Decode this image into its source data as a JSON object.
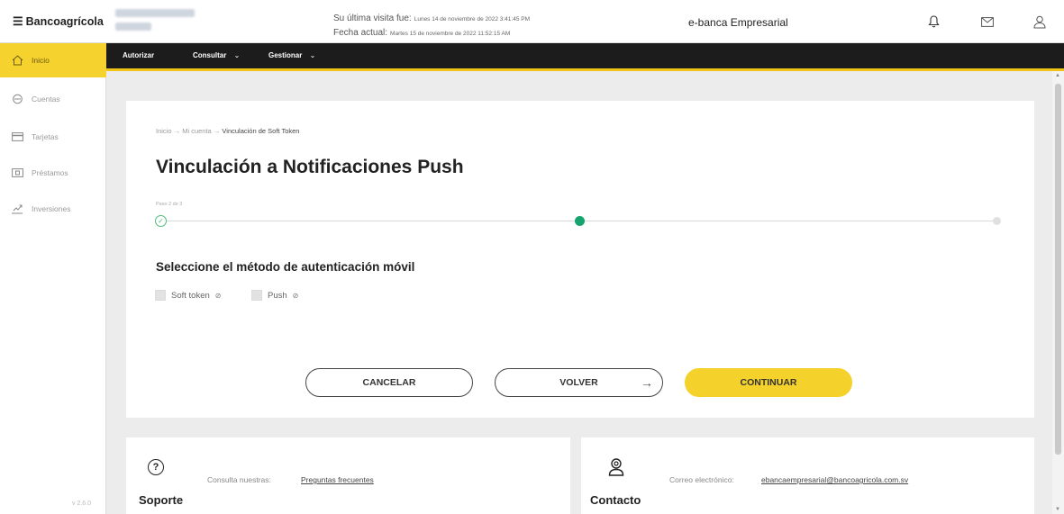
{
  "header": {
    "brand": "Bancoagrícola",
    "last_visit_label": "Su última visita fue:",
    "last_visit_value": "Lunes 14 de noviembre de 2022 3:41:45 PM",
    "current_date_label": "Fecha actual:",
    "current_date_value": "Martes 15 de noviembre de 2022 11:52:15 AM",
    "portal_name": "e-banca Empresarial",
    "icons": [
      "bell-icon",
      "mail-icon",
      "user-icon"
    ]
  },
  "sidebar": {
    "items": [
      {
        "label": "Inicio",
        "icon": "home-icon",
        "active": true
      },
      {
        "label": "Cuentas",
        "icon": "accounts-icon",
        "active": false
      },
      {
        "label": "Tarjetas",
        "icon": "card-icon",
        "active": false
      },
      {
        "label": "Préstamos",
        "icon": "loan-icon",
        "active": false
      },
      {
        "label": "Inversiones",
        "icon": "investment-icon",
        "active": false
      }
    ],
    "version": "v 2.6.0"
  },
  "nav": {
    "items": [
      {
        "label": "Autorizar",
        "has_dropdown": false
      },
      {
        "label": "Consultar",
        "has_dropdown": true
      },
      {
        "label": "Gestionar",
        "has_dropdown": true
      }
    ]
  },
  "breadcrumb": {
    "items": [
      "Inicio",
      "Mi cuenta",
      "Vinculación de Soft Token"
    ]
  },
  "page": {
    "title": "Vinculación a Notificaciones Push",
    "step_label": "Paso 2 de 3",
    "current_step": 2,
    "total_steps": 3,
    "subtitle": "Seleccione el método de autenticación móvil",
    "options": [
      {
        "label": "Soft token",
        "checked": false
      },
      {
        "label": "Push",
        "checked": false
      }
    ]
  },
  "buttons": {
    "cancel": "CANCELAR",
    "back": "VOLVER",
    "continue": "CONTINUAR"
  },
  "support": {
    "title": "Soporte",
    "prompt": "Consulta nuestras:",
    "link": "Preguntas frecuentes"
  },
  "contact": {
    "title": "Contacto",
    "prompt": "Correo electrónico:",
    "email": "ebancaempresarial@bancoagricola.com.sv"
  },
  "colors": {
    "accent_yellow": "#f5d22b",
    "step_green": "#16a36e",
    "nav_dark": "#1c1c1c"
  }
}
